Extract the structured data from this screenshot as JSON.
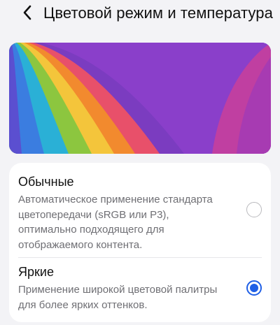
{
  "header": {
    "back_icon": "chevron-left-icon",
    "title": "Цветовой режим и температура"
  },
  "preview": {
    "icon": "rainbow-wallpaper-preview",
    "colors": [
      "#27a7d8",
      "#f0c63a",
      "#f08a2c",
      "#e0456e",
      "#8b3fc9"
    ]
  },
  "modes": [
    {
      "title": "Обычные",
      "description": "Автоматическое применение стандарта цветопередачи (sRGB или P3), оптимально подходящего для отображаемого контента.",
      "selected": false
    },
    {
      "title": "Яркие",
      "description": "Применение широкой цветовой палитры для более ярких оттенков.",
      "selected": true
    }
  ],
  "colors": {
    "accent": "#1f5fe6",
    "background": "#f3f3f6",
    "card": "#ffffff",
    "secondary_text": "#6f6f74"
  }
}
